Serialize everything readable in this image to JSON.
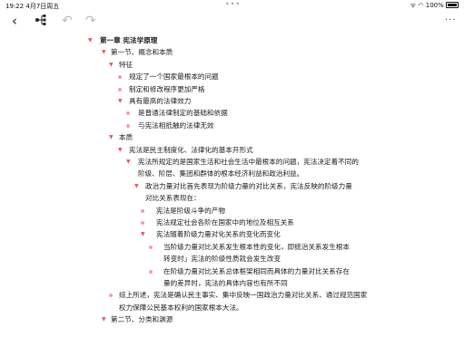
{
  "status_bar": {
    "time": "19:22  4月7日周五",
    "dots": "•••",
    "battery": "100%"
  },
  "toolbar": {
    "back_icon": "chevron-left-icon",
    "tree_icon": "mindmap-icon",
    "undo_icon": "undo-icon",
    "redo_icon": "redo-icon",
    "more_icon": "more-icon"
  },
  "colors": {
    "marker": "#e0585f",
    "dot": "#f1a0a5"
  },
  "outline": [
    {
      "level": 0,
      "marker": "tri",
      "bold": true,
      "text": "第一章 宪法学原理"
    },
    {
      "level": 1,
      "marker": "tri",
      "text": "第一节、概念和本质"
    },
    {
      "level": 2,
      "marker": "tri",
      "text": "特征"
    },
    {
      "level": 3,
      "marker": "dot",
      "text": "规定了一个国家最根本的问题"
    },
    {
      "level": 3,
      "marker": "dot",
      "text": "制定和修改程序更加严格"
    },
    {
      "level": 3,
      "marker": "tri",
      "text": "具有最高的法律效力"
    },
    {
      "level": 4,
      "marker": "dot",
      "text": "是普通法律制定的基础和依据"
    },
    {
      "level": 4,
      "marker": "dot",
      "text": "与宪法相抵触的法律无效"
    },
    {
      "level": 2,
      "marker": "tri",
      "text": "本质"
    },
    {
      "level": 3,
      "marker": "tri",
      "text": "宪法是民主制度化、法律化的基本开形式"
    },
    {
      "level": 4,
      "marker": "tri",
      "text": "宪法所规定的是国家生活和社会生活中最根本的问题，宪法决定着不同的阶级、阶层、集团和群体的根本经济利益和政治利益。"
    },
    {
      "level": 5,
      "marker": "tri",
      "text": "政治力量对比首先表现为阶级力量的对比关系，宪法反映的阶级力量对比关系表现在："
    },
    {
      "level": 6,
      "marker": "dot",
      "text": "宪法是阶级斗争的产物"
    },
    {
      "level": 6,
      "marker": "dot",
      "text": "宪法规定社会各阶在国家中的地位及相互关系"
    },
    {
      "level": 6,
      "marker": "tri",
      "text": "宪法随着阶级力量对化关系的变化而变化"
    },
    {
      "level": 7,
      "marker": "dot",
      "text": "当阶级力量对比关系发生根本性的变化，即统治关系发生根本转变时」宪法的阶级性质就会发生改变"
    },
    {
      "level": 7,
      "marker": "dot",
      "text": "在阶级力量对比关系总体框架相同而具体的力量对比关系存在量的差异时，宪法的具体内容也有所不同"
    },
    {
      "level": 2,
      "marker": "dot",
      "text": "综上所述，宪法是确认民主事实、集中反映一国政治力量对比关系、通过规范国家权力保障公民基本权利的国家根本大法。"
    },
    {
      "level": 1,
      "marker": "tri",
      "text": "第二节、分类和渊源"
    }
  ]
}
